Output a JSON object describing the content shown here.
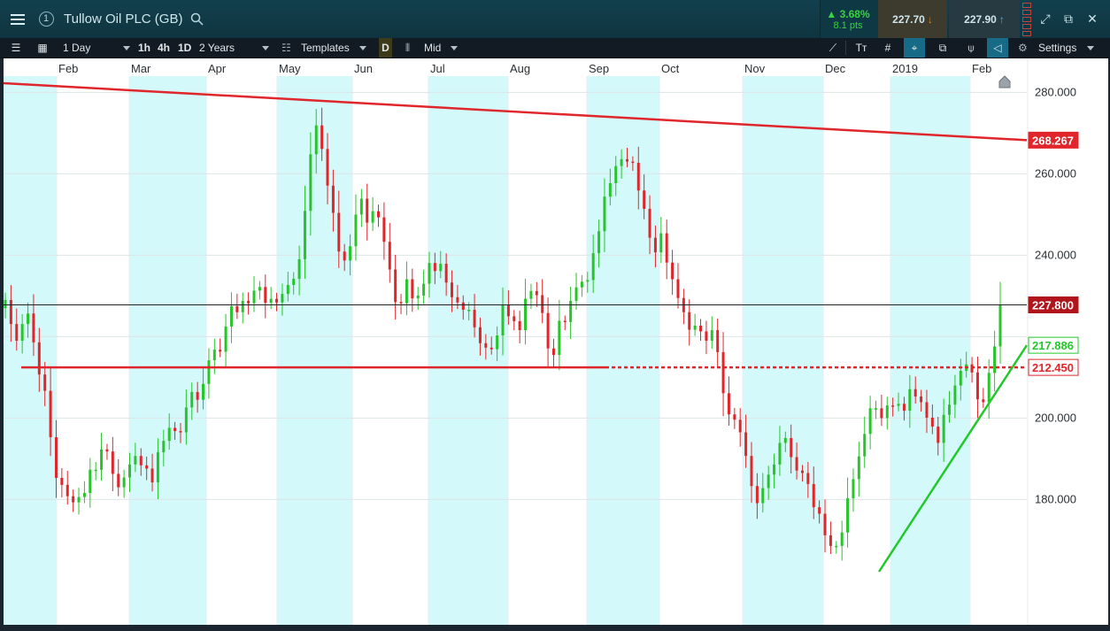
{
  "header": {
    "instrument": "Tullow Oil PLC (GB)",
    "instrument_number": "1",
    "change_percent": "3.68%",
    "change_points": "8.1 pts",
    "sell_price": "227.70",
    "buy_price": "227.90",
    "icons": [
      "menu-icon",
      "search-icon",
      "arrow-down-icon",
      "arrow-up-icon",
      "expand-icon",
      "popout-icon",
      "close-icon"
    ]
  },
  "toolbar": {
    "interval": "1 Day",
    "quick_intervals": [
      "1h",
      "4h",
      "1D"
    ],
    "period": "2 Years",
    "templates_label": "Templates",
    "d_label": "D",
    "price_type": "Mid",
    "settings_label": "Settings"
  },
  "chart_data": {
    "type": "candlestick",
    "x_ticks": [
      "Feb",
      "Mar",
      "Apr",
      "May",
      "Jun",
      "Jul",
      "Aug",
      "Sep",
      "Oct",
      "Nov",
      "Dec",
      "2019",
      "Feb"
    ],
    "y_ticks": [
      "280.000",
      "260.000",
      "240.000",
      "200.000",
      "180.000"
    ],
    "ylim": [
      164,
      284
    ],
    "price_labels": {
      "resistance": "268.267",
      "last": "227.800",
      "trendline": "217.886",
      "support": "212.450"
    },
    "colors": {
      "up": "#27c42c",
      "down": "#e0262b",
      "resistance_line": "#e0262b",
      "support_line": "#e0262b",
      "trend_line": "#22c82a",
      "last_label": "#b0151b",
      "band": "#d3f9fa",
      "background": "#ffffff"
    },
    "closes": [
      229.0,
      223.1,
      219.0,
      223.1,
      225.7,
      218.6,
      210.7,
      206.7,
      195.3,
      185.3,
      183.6,
      180.8,
      179.3,
      180.6,
      181.6,
      187.3,
      187.3,
      192.3,
      191.8,
      186.3,
      183.0,
      185.4,
      188.6,
      190.7,
      188.4,
      187.6,
      184.2,
      191.6,
      194.4,
      197.6,
      196.8,
      196.5,
      202.6,
      206.4,
      204.5,
      208.4,
      214.2,
      216.8,
      216.3,
      222.5,
      227.5,
      226.0,
      228.8,
      228.2,
      231.3,
      232.2,
      228.3,
      229.3,
      228.4,
      230.5,
      232.7,
      234.2,
      239.0,
      250.9,
      264.8,
      271.9,
      266.1,
      257.1,
      250.4,
      240.9,
      238.7,
      242.2,
      250.0,
      253.9,
      248.0,
      250.8,
      249.3,
      243.3,
      236.5,
      228.5,
      228.2,
      234.1,
      229.4,
      230.1,
      233.0,
      238.1,
      236.1,
      237.9,
      233.3,
      229.7,
      228.4,
      226.6,
      226.6,
      222.3,
      218.4,
      217.3,
      216.9,
      220.3,
      227.9,
      225.0,
      223.8,
      221.6,
      229.3,
      231.2,
      230.2,
      225.8,
      217.1,
      215.5,
      223.9,
      223.6,
      228.8,
      232.1,
      233.5,
      233.9,
      240.5,
      245.9,
      254.4,
      257.7,
      261.9,
      263.6,
      263.0,
      262.7,
      255.9,
      251.4,
      244.3,
      240.7,
      245.4,
      238.2,
      234.1,
      229.5,
      226.0,
      221.7,
      222.7,
      221.3,
      219.0,
      221.6,
      216.2,
      206.1,
      200.9,
      199.6,
      196.5,
      190.7,
      183.3,
      179.1,
      182.8,
      186.1,
      188.6,
      193.9,
      195.1,
      190.4,
      187.1,
      186.5,
      183.8,
      178.1,
      176.5,
      171.2,
      168.6,
      168.6,
      171.9,
      180.3,
      185.0,
      190.6,
      196.1,
      202.4,
      202.4,
      200.0,
      203.1,
      203.0,
      203.5,
      201.8,
      207.1,
      205.3,
      203.9,
      200.1,
      197.9,
      193.9,
      200.8,
      203.3,
      208.0,
      211.6,
      213.2,
      211.2,
      204.6,
      203.9,
      211.1,
      217.6,
      227.8
    ]
  }
}
